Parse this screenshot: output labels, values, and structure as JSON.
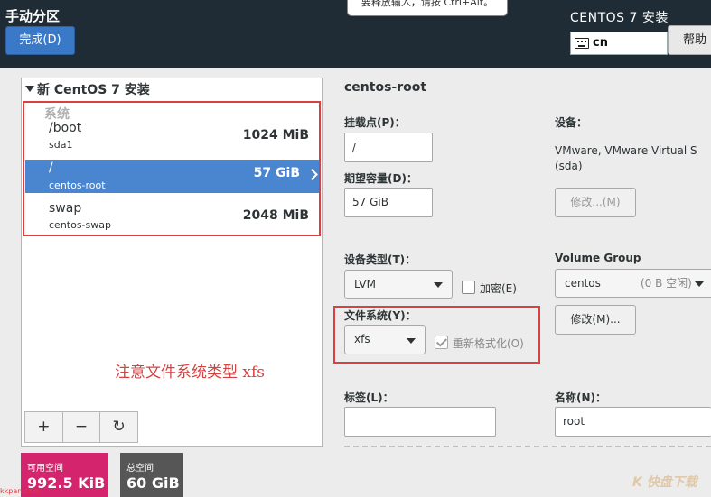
{
  "header": {
    "title": "手动分区",
    "done_label": "完成(D)",
    "tooltip_text": "要释放输入，请按 Ctrl+Alt。",
    "product": "CENTOS 7 安装",
    "keyboard_layout": "cn",
    "help_label": "帮助"
  },
  "left": {
    "install_title": "新 CentOS 7 安装",
    "group_label": "系统",
    "mounts": [
      {
        "name": "/boot",
        "device": "sda1",
        "size": "1024 MiB",
        "selected": false
      },
      {
        "name": "/",
        "device": "centos-root",
        "size": "57 GiB",
        "selected": true
      },
      {
        "name": "swap",
        "device": "centos-swap",
        "size": "2048 MiB",
        "selected": false
      }
    ],
    "annotation": "注意文件系统类型 xfs",
    "toolbar": {
      "add": "+",
      "remove": "−",
      "refresh": "↻"
    }
  },
  "space": {
    "available_label": "可用空间",
    "available_value": "992.5 KiB",
    "total_label": "总空间",
    "total_value": "60 GiB"
  },
  "right": {
    "section_title": "centos-root",
    "mount_point_label": "挂载点(P)：",
    "mount_point_value": "/",
    "desired_capacity_label": "期望容量(D)：",
    "desired_capacity_value": "57 GiB",
    "device_label": "设备：",
    "device_desc": "VMware, VMware Virtual S (sda)",
    "modify_device_label": "修改...(M)",
    "device_type_label": "设备类型(T)：",
    "device_type_value": "LVM",
    "encrypt_label": "加密(E)",
    "volume_group_label": "Volume Group",
    "volume_group_value": "centos",
    "volume_group_free": "(0 B 空闲)",
    "modify_vg_label": "修改(M)...",
    "filesystem_label": "文件系统(Y)：",
    "filesystem_value": "xfs",
    "reformat_label": "重新格式化(O)",
    "tag_label": "标签(L)：",
    "tag_value": "",
    "name_label": "名称(N)：",
    "name_value": "root"
  },
  "watermarks": {
    "left": "kkpan.com",
    "right": "K 快盘下载"
  }
}
